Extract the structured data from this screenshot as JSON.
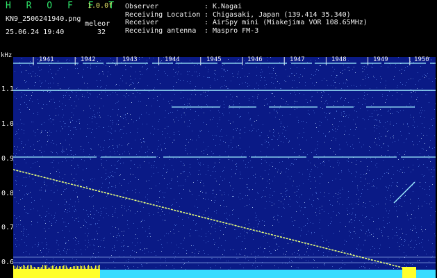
{
  "header": {
    "brand": "H R O F F T",
    "version": "1.0.0f",
    "filename": "KN9_2506241940.png",
    "mode": "meleor",
    "datetime": "25.06.24 19:40",
    "count": "32"
  },
  "info": [
    {
      "key": "Observer",
      "value": "K.Nagai"
    },
    {
      "key": "Receiving Location",
      "value": "Chigasaki, Japan (139.414 35.340)"
    },
    {
      "key": "Receiver",
      "value": "AirSpy mini (Miakejima VOR 108.65MHz)"
    },
    {
      "key": "Receiving antenna",
      "value": "Maspro FM-3"
    }
  ],
  "axis": {
    "unit": "kHz",
    "y_ticks": [
      "1.1",
      "1.0",
      "0.9",
      "0.8",
      "0.7",
      "0.6"
    ],
    "x_ticks": [
      "1941",
      "1942",
      "1943",
      "1944",
      "1945",
      "1946",
      "1947",
      "1948",
      "1949",
      "1950"
    ]
  },
  "colors": {
    "background": "#0a1a86",
    "signal": "#9ff0ff",
    "trail": "#e6ff7a",
    "bottom_yellow": "#ffff2a",
    "bottom_cyan": "#38dcff"
  }
}
